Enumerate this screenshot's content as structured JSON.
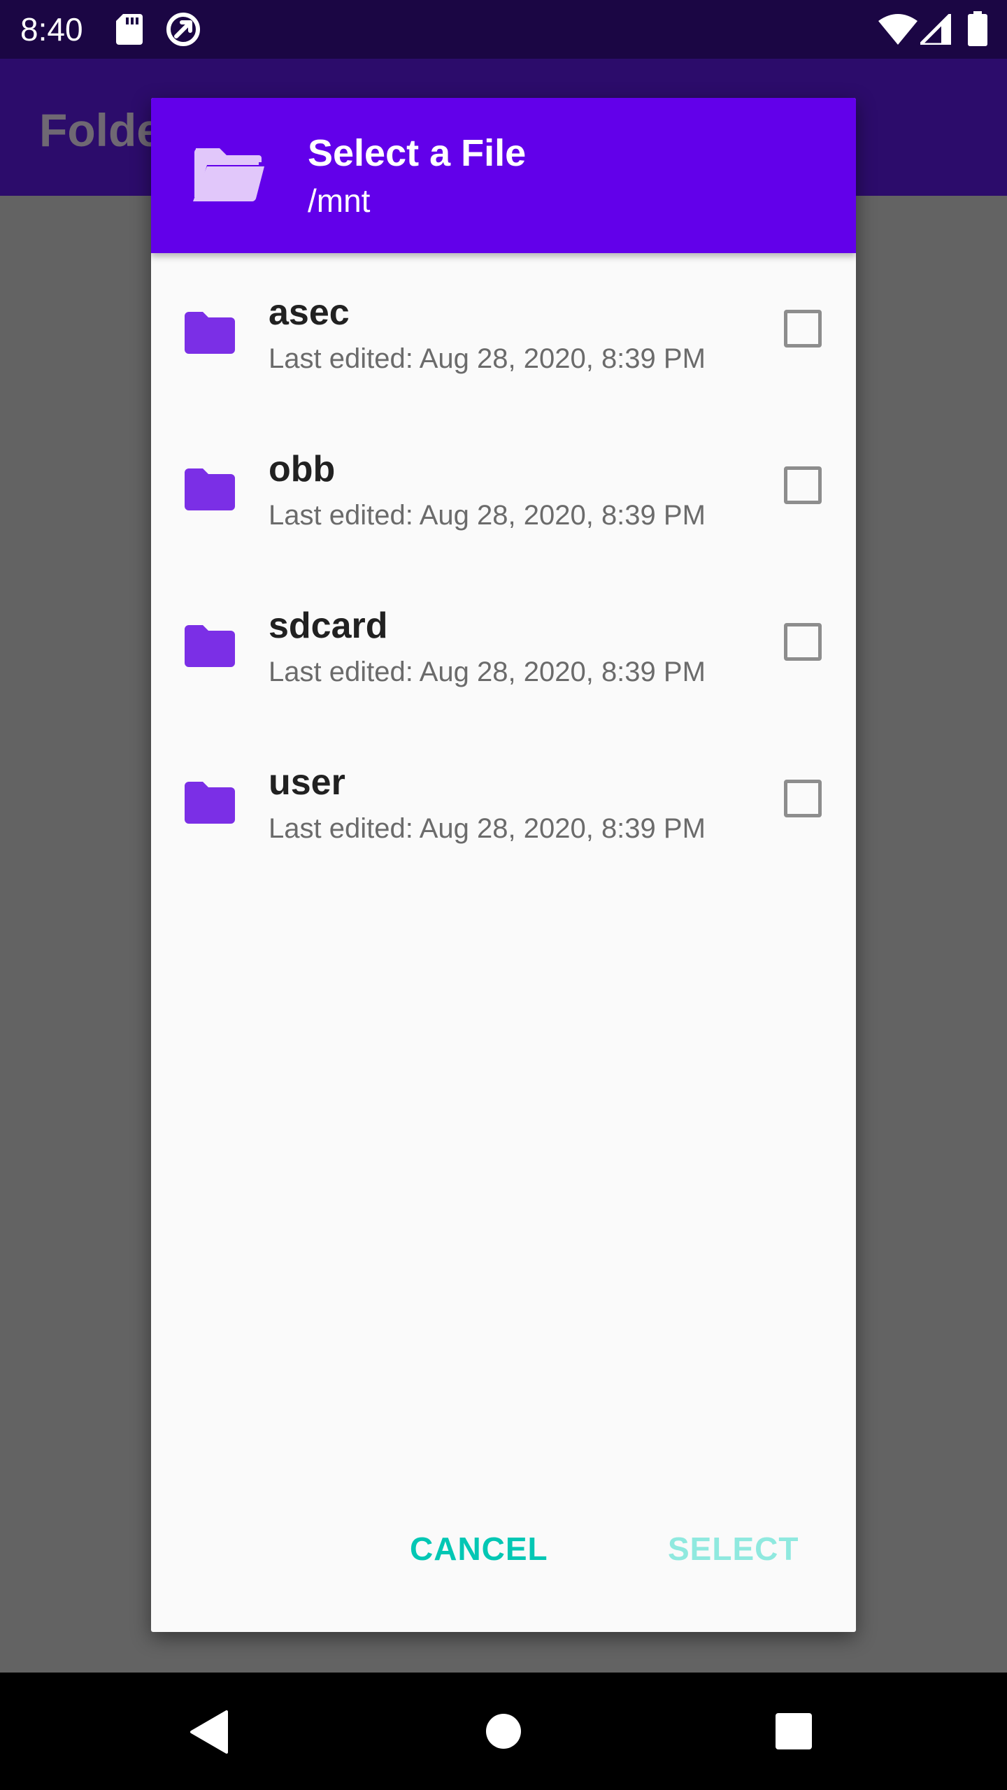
{
  "status_bar": {
    "time": "8:40",
    "icons": [
      "sd-card-icon",
      "data-saver-icon",
      "wifi-icon",
      "cell-signal-icon",
      "battery-icon"
    ]
  },
  "app_bar": {
    "title": "Folde"
  },
  "dialog": {
    "title": "Select a File",
    "path": "/mnt",
    "header_icon": "folder-open-icon",
    "accent_color": "#6200ea",
    "items": [
      {
        "name": "asec",
        "meta": "Last edited: Aug 28, 2020, 8:39 PM",
        "icon": "folder-icon",
        "checked": false
      },
      {
        "name": "obb",
        "meta": "Last edited: Aug 28, 2020, 8:39 PM",
        "icon": "folder-icon",
        "checked": false
      },
      {
        "name": "sdcard",
        "meta": "Last edited: Aug 28, 2020, 8:39 PM",
        "icon": "folder-icon",
        "checked": false
      },
      {
        "name": "user",
        "meta": "Last edited: Aug 28, 2020, 8:39 PM",
        "icon": "folder-icon",
        "checked": false
      }
    ],
    "actions": {
      "cancel_label": "CANCEL",
      "select_label": "SELECT",
      "button_color": "#03c7b4"
    }
  },
  "nav_bar": {
    "icons": [
      "back-icon",
      "home-icon",
      "recents-icon"
    ]
  }
}
